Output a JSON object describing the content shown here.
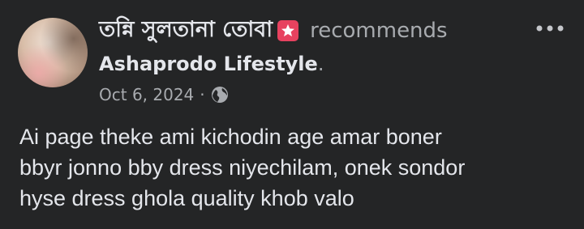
{
  "post": {
    "author": {
      "name": "তন্নি সুলতানা তোবা",
      "action": "recommends"
    },
    "page": {
      "name": "Ashaprodo Lifestyle",
      "trailing": "."
    },
    "meta": {
      "date": "Oct 6, 2024",
      "separator": "·",
      "privacy_icon": "globe-icon"
    },
    "badge_icon": "star-badge-icon",
    "more_icon": "more-options-icon",
    "body_lines": [
      "Ai page theke ami kichodin age amar boner",
      "bbyr jonno bby dress niyechilam, onek sondor",
      "hyse dress ghola quality khob valo"
    ]
  },
  "colors": {
    "background": "#242526",
    "primary_text": "#e4e6eb",
    "secondary_text": "#a8abaf",
    "badge": "#e7425f"
  }
}
